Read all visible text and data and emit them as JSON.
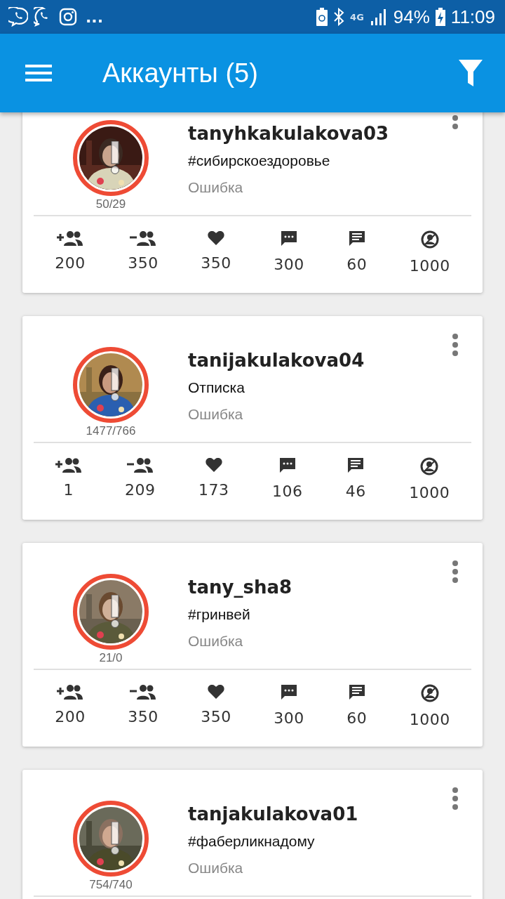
{
  "status_bar": {
    "more": "...",
    "network": "4G",
    "battery": "94%",
    "time": "11:09"
  },
  "app_bar": {
    "title": "Аккаунты (5)"
  },
  "accounts": [
    {
      "username": "tanyhkakulakova03",
      "subtitle": "#сибирскоездоровье",
      "status": "Ошибка",
      "counter": "50/29",
      "error": true,
      "stats": [
        {
          "kind": "follow",
          "value": "200"
        },
        {
          "kind": "unfollow",
          "value": "350"
        },
        {
          "kind": "like",
          "value": "350"
        },
        {
          "kind": "comment",
          "value": "300"
        },
        {
          "kind": "message",
          "value": "60"
        },
        {
          "kind": "account",
          "value": "1000"
        }
      ]
    },
    {
      "username": "tanijakulakova04",
      "subtitle": "Отписка",
      "status": "Ошибка",
      "counter": "1477/766",
      "error": true,
      "stats": [
        {
          "kind": "follow",
          "value": "1"
        },
        {
          "kind": "unfollow",
          "value": "209"
        },
        {
          "kind": "like",
          "value": "173"
        },
        {
          "kind": "comment",
          "value": "106"
        },
        {
          "kind": "message",
          "value": "46"
        },
        {
          "kind": "account",
          "value": "1000"
        }
      ]
    },
    {
      "username": "tany_sha8",
      "subtitle": "#гринвей",
      "status": "Ошибка",
      "counter": "21/0",
      "error": true,
      "stats": [
        {
          "kind": "follow",
          "value": "200"
        },
        {
          "kind": "unfollow",
          "value": "350"
        },
        {
          "kind": "like",
          "value": "350"
        },
        {
          "kind": "comment",
          "value": "300"
        },
        {
          "kind": "message",
          "value": "60"
        },
        {
          "kind": "account",
          "value": "1000"
        }
      ]
    },
    {
      "username": "tanjakulakova01",
      "subtitle": "#фаберликнадому",
      "status": "Ошибка",
      "counter": "754/740",
      "error": true
    }
  ]
}
